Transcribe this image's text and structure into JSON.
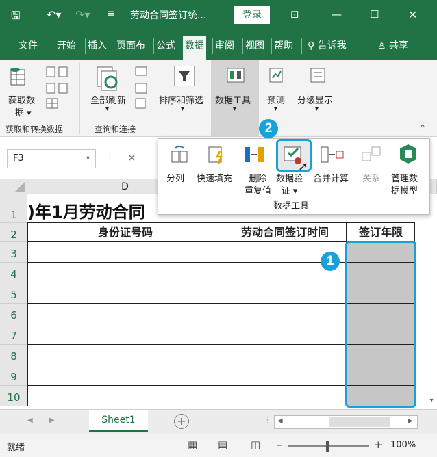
{
  "titlebar": {
    "title": "劳动合同签订统...",
    "login": "登录"
  },
  "tabs": [
    {
      "label": "文件"
    },
    {
      "label": "开始"
    },
    {
      "label": "插入"
    },
    {
      "label": "页面布"
    },
    {
      "label": "公式"
    },
    {
      "label": "数据"
    },
    {
      "label": "审阅"
    },
    {
      "label": "视图"
    },
    {
      "label": "帮助"
    },
    {
      "label": "告诉我"
    },
    {
      "label": "共享"
    }
  ],
  "ribbon": {
    "get_data": "获取数",
    "get_data2": "据",
    "refresh_all": "全部刷新",
    "sort_filter": "排序和筛选",
    "data_tools": "数据工具",
    "forecast": "预测",
    "outline": "分级显示",
    "group_get": "获取和转换数据",
    "group_query": "查询和连接"
  },
  "popup": {
    "split": "分列",
    "flash_fill": "快速填充",
    "remove_dup_1": "删除",
    "remove_dup_2": "重复值",
    "validation_1": "数据验",
    "validation_2": "证",
    "consolidate": "合并计算",
    "relationships": "关系",
    "manage_model_1": "管理数",
    "manage_model_2": "据模型",
    "group_label": "数据工具"
  },
  "formulabar": {
    "namebox": "F3"
  },
  "sheet": {
    "col_d": "D",
    "title_text": ")年1月劳动合同",
    "headers": [
      "身份证号码",
      "劳动合同签订时间",
      "签订年限"
    ],
    "row_numbers": [
      "1",
      "2",
      "3",
      "4",
      "5",
      "6",
      "7",
      "8",
      "9",
      "10"
    ]
  },
  "badges": {
    "step1": "1",
    "step2": "2"
  },
  "sheettabs": {
    "active": "Sheet1"
  },
  "status": {
    "ready": "就绪",
    "zoom": "100%"
  },
  "colors": {
    "accent": "#217346",
    "badge": "#1aa0db",
    "selection": "#1a9fd9"
  }
}
